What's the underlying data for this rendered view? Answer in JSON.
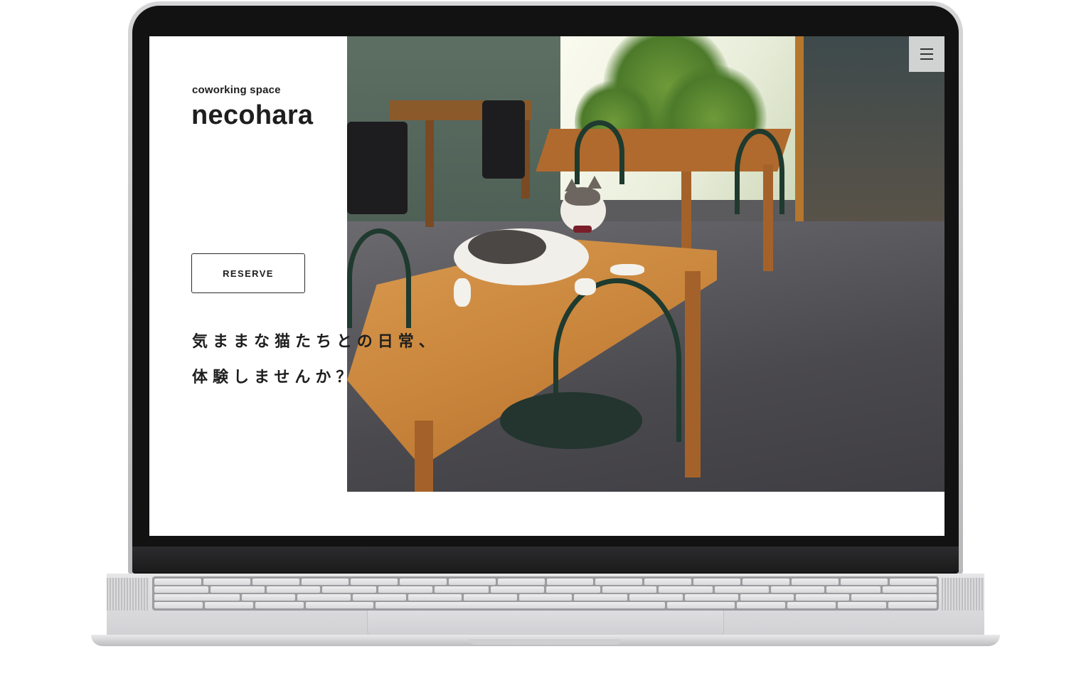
{
  "site": {
    "subtitle": "coworking space",
    "title": "necohara",
    "reserve_label": "RESERVE",
    "catchphrase": [
      "気ままな猫たちとの日常、",
      "体験しませんか？"
    ]
  },
  "header": {
    "menu_icon": "hamburger-menu-icon"
  },
  "hero": {
    "image_content": "cafe interior with cat lying on wooden table"
  },
  "colors": {
    "text": "#1e1e1e",
    "background": "#ffffff",
    "button_border": "#2a2a2a"
  }
}
